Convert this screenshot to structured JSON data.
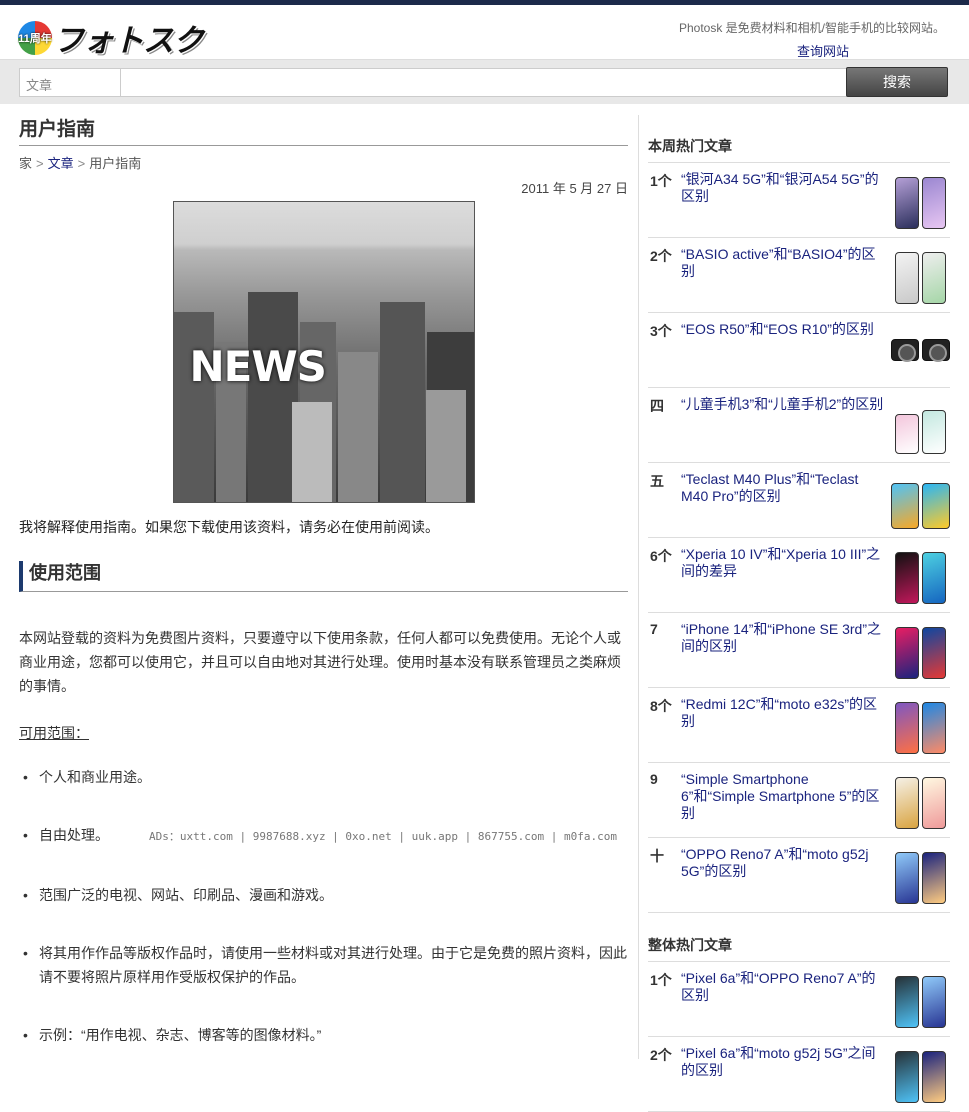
{
  "header": {
    "logo_badge": "11周年",
    "logo_text": "フォトスク",
    "tagline": "Photosk 是免费材料和相机/智能手机的比较网站。",
    "site_link": "查询网站"
  },
  "search": {
    "category": "文章",
    "placeholder": "",
    "button": "搜索"
  },
  "main": {
    "title": "用户指南",
    "breadcrumb": [
      "家",
      "文章",
      "用户指南"
    ],
    "date": "2011 年 5 月 27 日",
    "hero_text": "NEWS",
    "intro": "我将解释使用指南。如果您下载使用该资料，请务必在使用前阅读。",
    "section_title": "使用范围",
    "paragraph": "本网站登载的资料为免费图片资料，只要遵守以下使用条款，任何人都可以免费使用。无论个人或商业用途，您都可以使用它，并且可以自由地对其进行处理。使用时基本没有联系管理员之类麻烦的事情。",
    "subhead": "可用范围：",
    "uses": [
      "个人和商业用途。",
      "自由处理。",
      "范围广泛的电视、网站、印刷品、漫画和游戏。",
      "将其用作作品等版权作品时，请使用一些材料或对其进行处理。由于它是免费的照片资料，因此请不要将照片原样用作受版权保护的作品。",
      "示例：“用作电视、杂志、博客等的图像材料。”"
    ],
    "ad_text": "ADs：uxtt.com | 9987688.xyz | 0xo.net | uuk.app | 867755.com | m0fa.com"
  },
  "sidebar": {
    "weekly_title": "本周热门文章",
    "weekly": [
      {
        "rank": "1个",
        "title": "“银河A34 5G”和“银河A54 5G”的区别"
      },
      {
        "rank": "2个",
        "title": "“BASIO active”和“BASIO4”的区别"
      },
      {
        "rank": "3个",
        "title": "“EOS R50”和“EOS R10”的区别"
      },
      {
        "rank": "四",
        "title": "“儿童手机3”和“儿童手机2”的区别"
      },
      {
        "rank": "五",
        "title": "“Teclast M40 Plus”和“Teclast M40 Pro”的区别"
      },
      {
        "rank": "6个",
        "title": "“Xperia 10 IV”和“Xperia 10 III”之间的差异"
      },
      {
        "rank": "7",
        "title": "“iPhone 14”和“iPhone SE 3rd”之间的区别"
      },
      {
        "rank": "8个",
        "title": "“Redmi 12C”和“moto e32s”的区别"
      },
      {
        "rank": "9",
        "title": "“Simple Smartphone 6”和“Simple Smartphone 5”的区别"
      },
      {
        "rank": "十",
        "title": "“OPPO Reno7 A”和“moto g52j 5G”的区别"
      }
    ],
    "overall_title": "整体热门文章",
    "overall": [
      {
        "rank": "1个",
        "title": "“Pixel 6a”和“OPPO Reno7 A”的区别"
      },
      {
        "rank": "2个",
        "title": "“Pixel 6a”和“moto g52j 5G”之间的区别"
      }
    ],
    "colors": {
      "a34": [
        "#b49fd6",
        "#2b2f5c"
      ],
      "basio": [
        "#f3f3f3",
        "#c9c9c9"
      ],
      "kids": [
        "#f3c6dc",
        "#c3e8e0"
      ],
      "teclast": [
        "#4fc3f7",
        "#f9a825"
      ],
      "xperia": [
        "#111111",
        "#c2185b"
      ],
      "iphone": [
        "#e91e63",
        "#1a237e"
      ],
      "redmi": [
        "#7e57c2",
        "#ff7043"
      ],
      "simple": [
        "#f5f0e6",
        "#d9a441"
      ],
      "oppo": [
        "#90caf9",
        "#283593"
      ],
      "pixel": [
        "#263238",
        "#4fc3f7"
      ]
    }
  }
}
